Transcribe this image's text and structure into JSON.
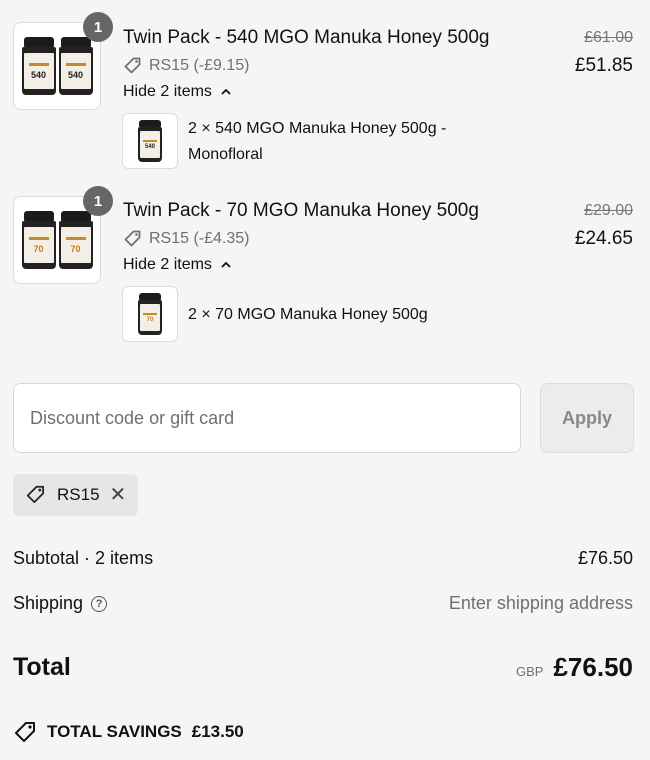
{
  "items": [
    {
      "quantity": "1",
      "title": "Twin Pack - 540 MGO Manuka Honey 500g",
      "discount": "RS15 (-£9.15)",
      "toggle_label": "Hide 2 items",
      "original_price": "£61.00",
      "price": "£51.85",
      "jar_label": "540",
      "sub_item": "2 × 540 MGO Manuka Honey 500g - Monofloral"
    },
    {
      "quantity": "1",
      "title": "Twin Pack - 70 MGO Manuka Honey 500g",
      "discount": "RS15 (-£4.35)",
      "toggle_label": "Hide 2 items",
      "original_price": "£29.00",
      "price": "£24.65",
      "jar_label": "70",
      "sub_item": "2 × 70 MGO Manuka Honey 500g"
    }
  ],
  "discount": {
    "placeholder": "Discount code or gift card",
    "apply_label": "Apply",
    "applied_code": "RS15"
  },
  "summary": {
    "subtotal_label": "Subtotal · 2 items",
    "subtotal_value": "£76.50",
    "shipping_label": "Shipping",
    "shipping_value": "Enter shipping address",
    "total_label": "Total",
    "currency": "GBP",
    "total_value": "£76.50",
    "savings_label": "TOTAL SAVINGS",
    "savings_value": "£13.50"
  },
  "colors": {
    "background": "#f5f5f5",
    "badge": "#666666",
    "muted_text": "#707070",
    "jar_accent_70": "#c97a16"
  }
}
